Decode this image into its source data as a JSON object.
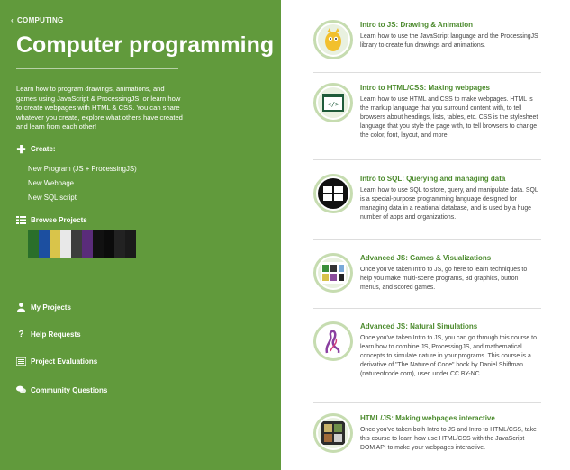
{
  "breadcrumb": {
    "label": "COMPUTING"
  },
  "sidebar": {
    "title": "Computer programming",
    "description": "Learn how to program drawings, animations, and games using JavaScript & ProcessingJS, or learn how to create webpages with HTML & CSS. You can share whatever you create, explore what others have created and learn from each other!",
    "create_label": "Create:",
    "create_items": [
      "New Program (JS + ProcessingJS)",
      "New Webpage",
      "New SQL script"
    ],
    "browse_label": "Browse Projects",
    "thumb_colors": [
      "#2a6f2a",
      "#1c4fa0",
      "#d9c44a",
      "#e8e8e8",
      "#3d3d3d",
      "#5a2c7a",
      "#111111",
      "#0b0b0b",
      "#222222",
      "#1a1a1a"
    ],
    "nav": [
      "My Projects",
      "Help Requests",
      "Project Evaluations",
      "Community Questions"
    ]
  },
  "courses": [
    {
      "title": "Intro to JS: Drawing & Animation",
      "desc": "Learn how to use the JavaScript language and the ProcessingJS library to create fun drawings and animations."
    },
    {
      "title": "Intro to HTML/CSS: Making webpages",
      "desc": "Learn how to use HTML and CSS to make webpages. HTML is the markup language that you surround content with, to tell browsers about headings, lists, tables, etc. CSS is the stylesheet language that you style the page with, to tell browsers to change the color, font, layout, and more."
    },
    {
      "title": "Intro to SQL: Querying and managing data",
      "desc": "Learn how to use SQL to store, query, and manipulate data. SQL is a special-purpose programming language designed for managing data in a relational database, and is used by a huge number of apps and organizations."
    },
    {
      "title": "Advanced JS: Games & Visualizations",
      "desc": "Once you've taken Intro to JS, go here to learn techniques to help you make multi-scene programs, 3d graphics, button menus, and scored games."
    },
    {
      "title": "Advanced JS: Natural Simulations",
      "desc": "Once you've taken Intro to JS, you can go through this course to learn how to combine JS, ProcessingJS, and mathematical concepts to simulate nature in your programs. This course is a derivative of \"The Nature of Code\" book by Daniel Shiffman (natureofcode.com), used under CC BY-NC."
    },
    {
      "title": "HTML/JS: Making webpages interactive",
      "desc": "Once you've taken both Intro to JS and Intro to HTML/CSS, take this course to learn how use HTML/CSS with the JavaScript DOM API to make your webpages interactive."
    }
  ]
}
